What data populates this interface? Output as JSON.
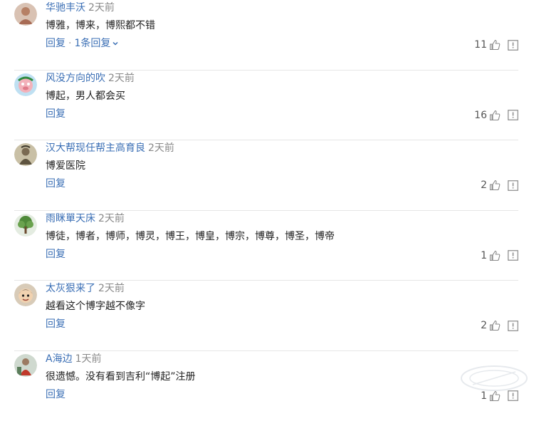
{
  "comments": [
    {
      "user": "华驰丰沃",
      "time": "2天前",
      "text": "博雅，博来，博熙都不错",
      "reply_label": "回复",
      "replies_label": "1条回复",
      "likes": "11",
      "avatar_color": "#c9a58f"
    },
    {
      "user": "风没方向的吹",
      "time": "2天前",
      "text": "博起，男人都会买",
      "reply_label": "回复",
      "likes": "16",
      "avatar_color": "#e9b6b0"
    },
    {
      "user": "汉大帮现任帮主高育良",
      "time": "2天前",
      "text": "博爱医院",
      "reply_label": "回复",
      "likes": "2",
      "avatar_color": "#8a7b62"
    },
    {
      "user": "雨眯單天床",
      "time": "2天前",
      "text": "博徒，博者，博师，博灵，博王，博皇，博宗，博尊，博圣，博帝",
      "reply_label": "回复",
      "likes": "1",
      "avatar_color": "#5f8f4a"
    },
    {
      "user": "太灰狠来了",
      "time": "2天前",
      "text": "越看这个博字越不像字",
      "reply_label": "回复",
      "likes": "2",
      "avatar_color": "#8a6a4e"
    },
    {
      "user": "A海边",
      "time": "1天前",
      "text": "很遗憾。没有看到吉利“博起”注册",
      "reply_label": "回复",
      "likes": "1",
      "avatar_color": "#6f8a6f"
    }
  ],
  "colors": {
    "link": "#3b6fb5",
    "time": "#888888",
    "separator": "#e6e6e6"
  },
  "icons": {
    "like": "thumb-up-icon",
    "report": "report-icon",
    "expand": "chevron-down-icon"
  }
}
